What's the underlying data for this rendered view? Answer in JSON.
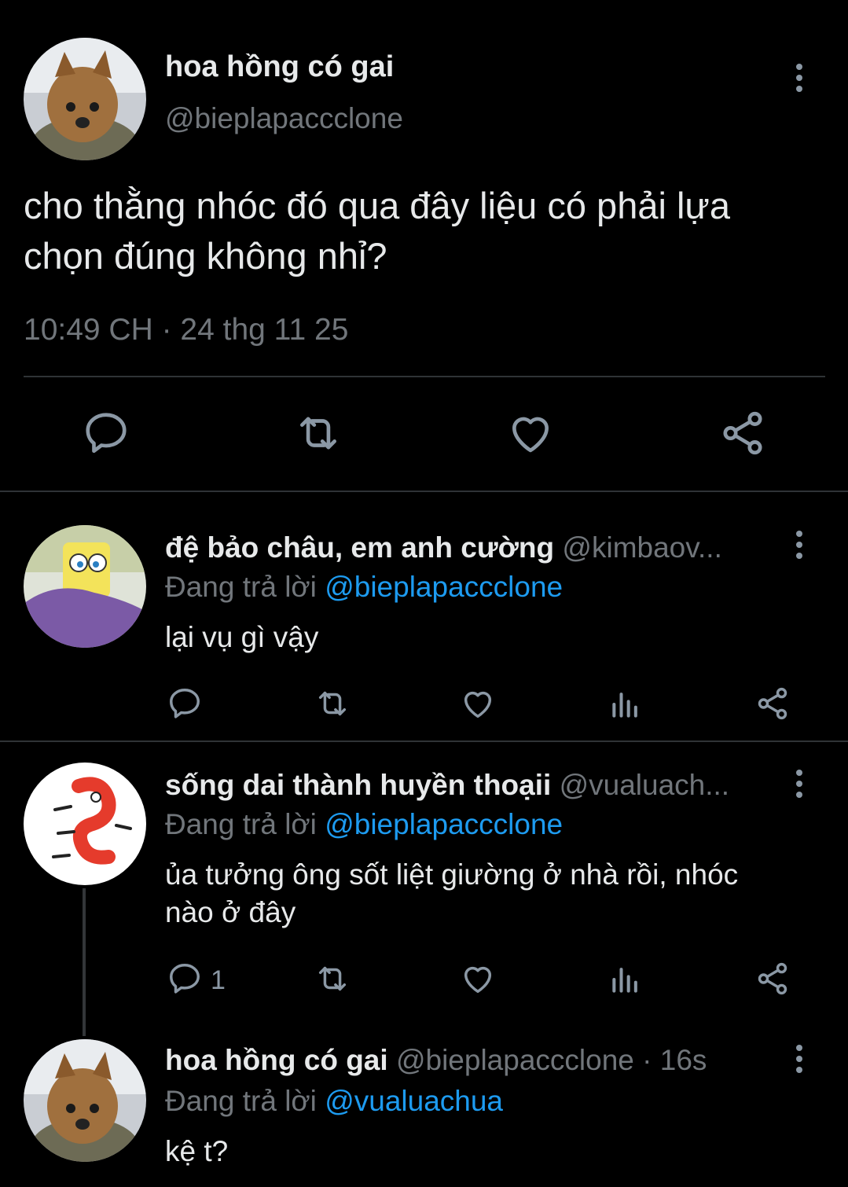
{
  "main_tweet": {
    "display_name": "hoa hồng có gai",
    "handle": "@bieplapaccclone",
    "text_line1": "cho thằng nhóc đó qua đây liệu có phải lựa",
    "text_line2": "chọn đúng không nhỉ?",
    "timestamp": "10:49 CH · 24 thg 11 25"
  },
  "replies": [
    {
      "display_name": "đệ bảo châu, em anh cường",
      "handle": "@kimbaov...",
      "replying_prefix": "Đang trả lời",
      "replying_to": "@bieplapaccclone",
      "text_line1": "lại vụ gì vậy",
      "text_line2": "",
      "reply_count": ""
    },
    {
      "display_name": "sống dai thành huyền thoạii",
      "handle": "@vualuach...",
      "replying_prefix": "Đang trả lời",
      "replying_to": "@bieplapaccclone",
      "text_line1": "ủa tưởng ông sốt liệt giường ở nhà rồi, nhóc",
      "text_line2": "nào ở đây",
      "reply_count": "1"
    },
    {
      "display_name": "hoa hồng có gai",
      "handle": "@bieplapaccclone · 16s",
      "replying_prefix": "Đang trả lời",
      "replying_to": "@vualuachua",
      "text_line1": "kệ t?",
      "text_line2": ""
    }
  ],
  "colors": {
    "background": "#000000",
    "text": "#e7e9ea",
    "muted": "#71767b",
    "link": "#1d9bf0",
    "divider": "#2f3336"
  },
  "icons": [
    "more-icon",
    "reply-icon",
    "retweet-icon",
    "like-icon",
    "views-icon",
    "share-icon"
  ]
}
